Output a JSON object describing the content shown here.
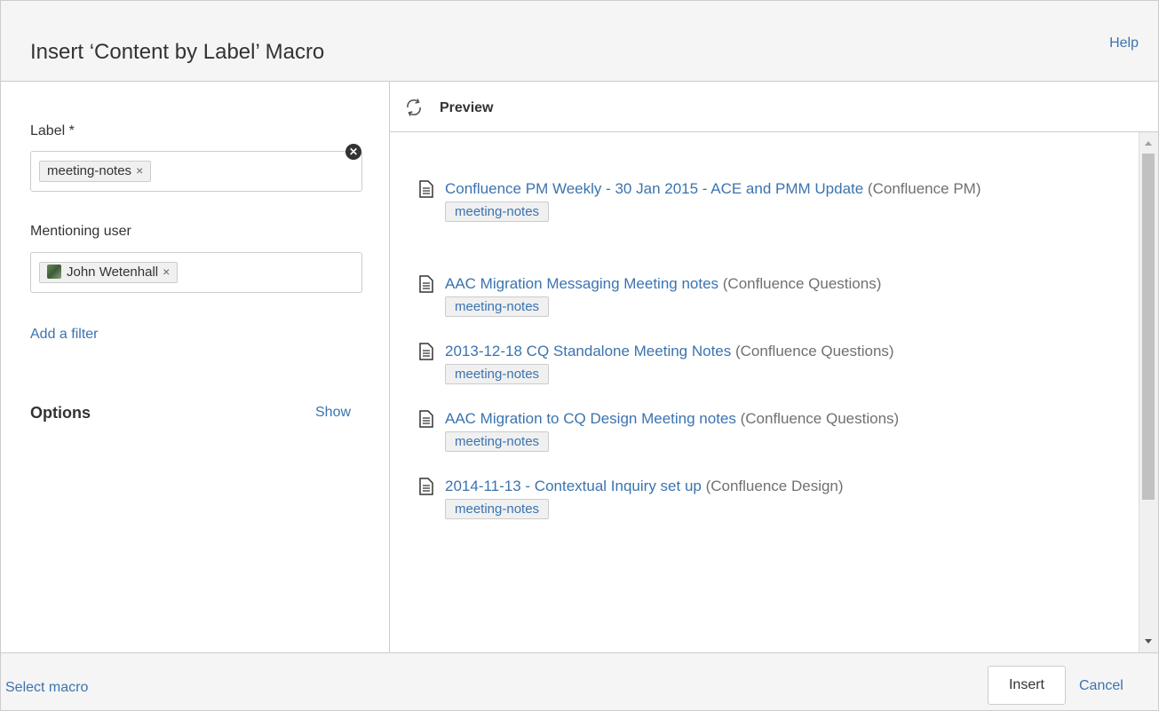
{
  "dialog": {
    "title": "Insert ‘Content by Label’ Macro",
    "help_label": "Help"
  },
  "form": {
    "label_field": {
      "label": "Label *",
      "tokens": [
        "meeting-notes"
      ],
      "remove_glyph": "×"
    },
    "mentioning_user": {
      "label": "Mentioning user",
      "clear_icon": "clear-icon",
      "tokens": [
        "John Wetenhall"
      ],
      "remove_glyph": "×"
    },
    "add_filter_label": "Add a filter",
    "options": {
      "title": "Options",
      "show_label": "Show"
    }
  },
  "preview": {
    "title": "Preview",
    "refresh_icon": "refresh-icon",
    "results": [
      {
        "title": "Confluence PM Weekly - 30 Jan 2015 - ACE and PMM Update",
        "space": " (Confluence PM)",
        "label": "meeting-notes"
      },
      {
        "title": "AAC Migration Messaging Meeting notes",
        "space": " (Confluence Questions)",
        "label": "meeting-notes"
      },
      {
        "title": "2013-12-18 CQ Standalone Meeting Notes",
        "space": " (Confluence Questions)",
        "label": "meeting-notes"
      },
      {
        "title": "AAC Migration to CQ Design Meeting notes",
        "space": " (Confluence Questions)",
        "label": "meeting-notes"
      },
      {
        "title": "2014-11-13 - Contextual Inquiry set up",
        "space": " (Confluence Design)",
        "label": "meeting-notes"
      }
    ]
  },
  "footer": {
    "select_macro_label": "Select macro",
    "insert_label": "Insert",
    "cancel_label": "Cancel"
  },
  "colors": {
    "link": "#3b73af",
    "text": "#333333",
    "muted": "#707070",
    "border": "#cccccc",
    "panel_bg": "#f5f5f5"
  }
}
